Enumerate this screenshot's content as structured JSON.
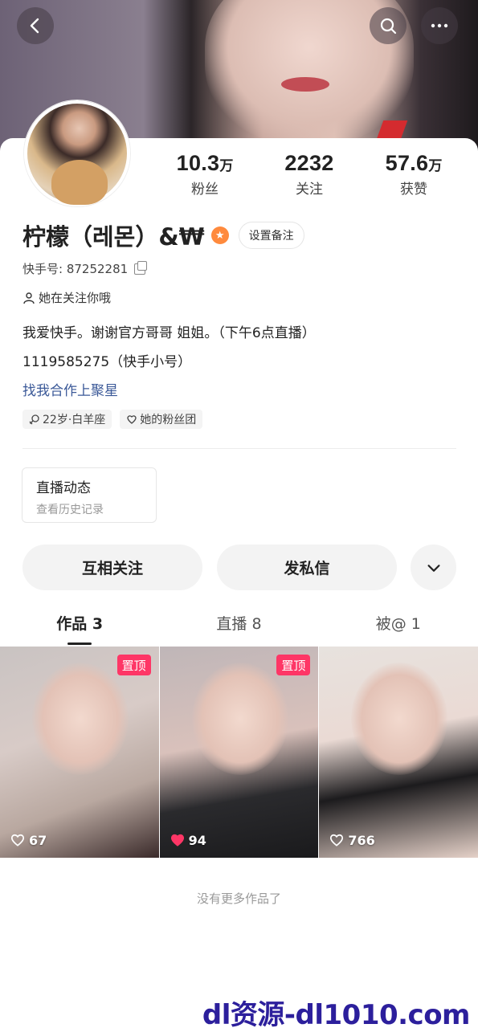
{
  "header": {
    "back_icon": "chevron-left-icon",
    "search_icon": "search-icon",
    "more_icon": "more-dots-icon"
  },
  "profile": {
    "stats": [
      {
        "num": "10.3",
        "unit": "万",
        "label": "粉丝"
      },
      {
        "num": "2232",
        "unit": "",
        "label": "关注"
      },
      {
        "num": "57.6",
        "unit": "万",
        "label": "获赞"
      }
    ],
    "name": "柠檬（레몬）&₩",
    "remark_button": "设置备注",
    "kuaishou_id": "快手号: 87252281",
    "follows_you": "她在关注你哦",
    "bio_line1": "我爱快手。谢谢官方哥哥 姐姐。（下午6点直播）",
    "bio_line2": "1119585275（快手小号）",
    "business_link": "找我合作上聚星",
    "tags": [
      "22岁·白羊座",
      "她的粉丝团"
    ]
  },
  "live_card": {
    "title": "直播动态",
    "subtitle": "查看历史记录"
  },
  "actions": {
    "mutual_follow": "互相关注",
    "message": "发私信"
  },
  "tabs": [
    "作品 3",
    "直播 8",
    "被@ 1"
  ],
  "videos": [
    {
      "pinned": "置顶",
      "likes": "67",
      "liked": false
    },
    {
      "pinned": "置顶",
      "likes": "94",
      "liked": true
    },
    {
      "pinned": "",
      "likes": "766",
      "liked": false
    }
  ],
  "footer": {
    "no_more": "没有更多作品了",
    "watermark": "dl资源-dl1010.com"
  },
  "colors": {
    "pin_badge": "#fe3666",
    "link": "#3b5998",
    "liked_heart": "#fe3666",
    "verified_badge": "#ff8a3d"
  }
}
